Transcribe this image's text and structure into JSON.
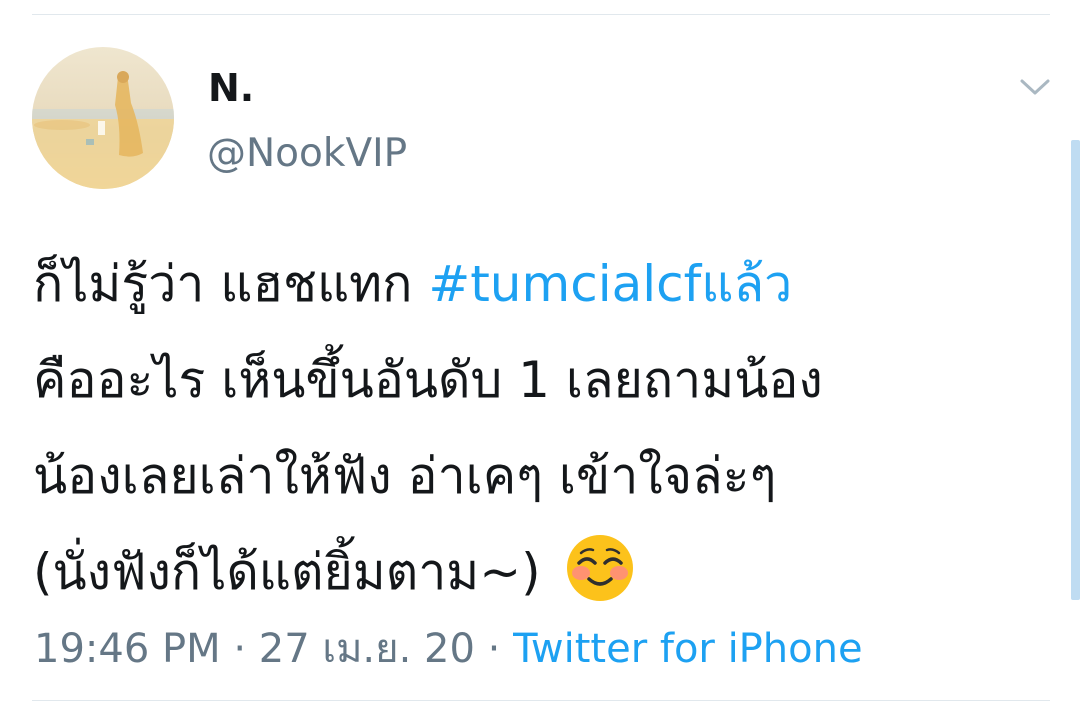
{
  "tweet": {
    "author": {
      "display_name": "N.",
      "handle": "@NookVIP",
      "avatar_icon": "beach-photo-avatar"
    },
    "menu_icon": "chevron-down-icon",
    "text": {
      "line1_prefix": "ก็ไม่รู้ว่า แฮชแทก ",
      "hashtag": "#tumcialcfแล้ว",
      "line2": "คืออะไร เห็นขึ้นอันดับ 1 เลยถามน้อง",
      "line3": "น้องเลยเล่าให้ฟัง อ่าเคๆ เข้าใจล่ะๆ",
      "line4": "(นั่งฟังก็ได้แต่ยิ้มตาม~)",
      "emoji": "smiling-face-with-blush-emoji"
    },
    "meta": {
      "time": "19:46 PM",
      "separator": " · ",
      "date": "27 เม.ย. 20",
      "source": "Twitter for iPhone"
    }
  },
  "colors": {
    "text": "#14171a",
    "secondary": "#657786",
    "link": "#1da1f2",
    "divider": "#e1e8ed"
  }
}
